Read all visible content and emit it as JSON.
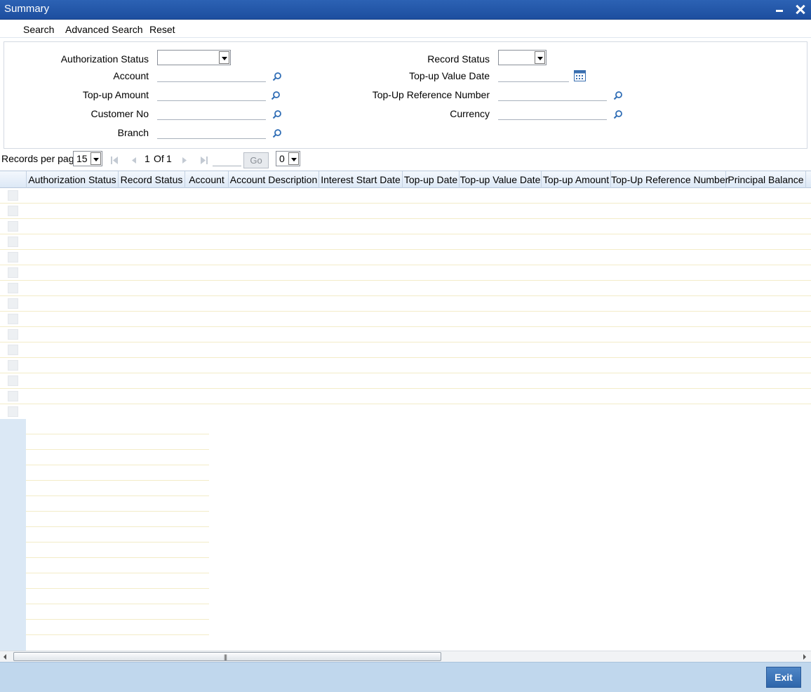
{
  "window": {
    "title": "Summary"
  },
  "toolbar": {
    "search": "Search",
    "advanced_search": "Advanced Search",
    "reset": "Reset"
  },
  "search_form": {
    "authorization_status_label": "Authorization Status",
    "account_label": "Account",
    "topup_amount_label": "Top-up Amount",
    "customer_no_label": "Customer No",
    "branch_label": "Branch",
    "record_status_label": "Record Status",
    "topup_value_date_label": "Top-up Value Date",
    "topup_reference_number_label": "Top-Up Reference Number",
    "currency_label": "Currency"
  },
  "pagination": {
    "records_per_page_label": "Records per page",
    "records_per_page_value": "15",
    "page_current": "1",
    "page_of": "Of",
    "page_total": "1",
    "go_label": "Go",
    "jump_select_value": "0"
  },
  "grid": {
    "columns": [
      "Authorization Status",
      "Record Status",
      "Account",
      "Account Description",
      "Interest Start Date",
      "Top-up Date",
      "Top-up Value Date",
      "Top-up Amount",
      "Top-Up Reference Number",
      "Principal Balance"
    ]
  },
  "footer": {
    "exit_label": "Exit"
  },
  "colors": {
    "title_bar": "#2c62b4",
    "footer": "#c0d7ed",
    "exit_button": "#3a73b8"
  },
  "icons": {
    "lookup": "search-magnifier-icon",
    "calendar": "calendar-icon",
    "close": "close-icon",
    "minimize": "minimize-icon"
  }
}
